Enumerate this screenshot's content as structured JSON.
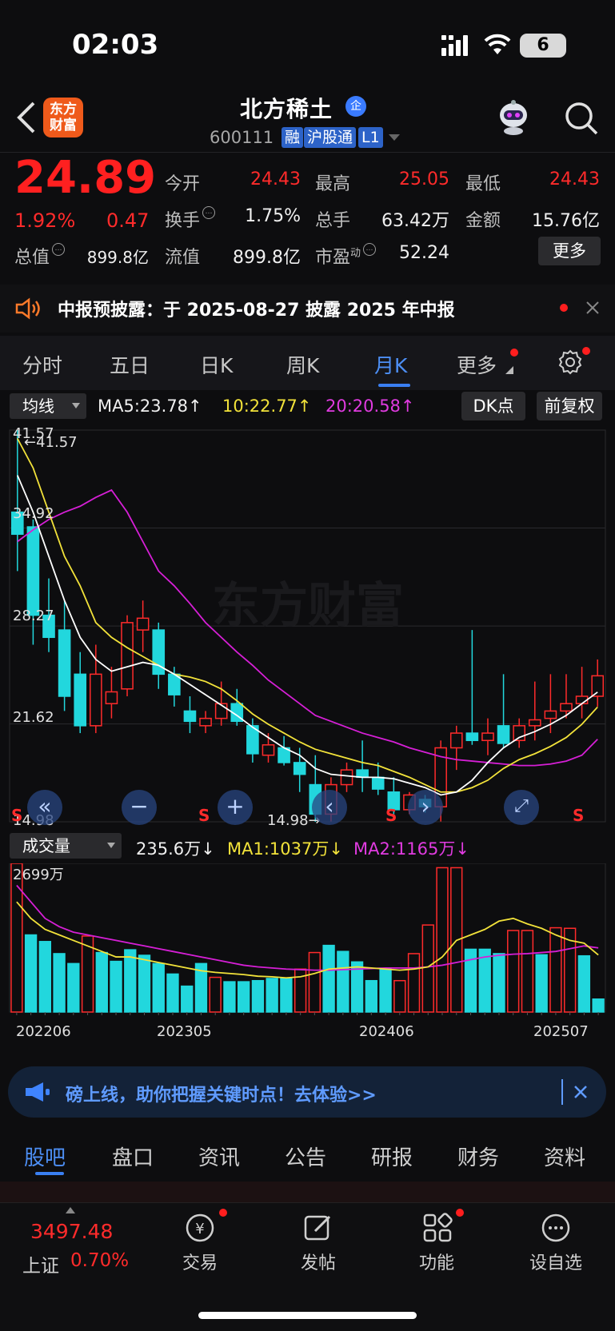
{
  "status": {
    "time": "02:03",
    "battery": "6"
  },
  "header": {
    "name": "北方稀土",
    "badge": "企",
    "code": "600111",
    "tags": [
      "融",
      "沪股通",
      "L1"
    ],
    "logo_lines": [
      "东方",
      "财富"
    ]
  },
  "quote": {
    "price": "24.89",
    "pct": "1.92%",
    "chg": "0.47",
    "open_label": "今开",
    "open": "24.43",
    "high_label": "最高",
    "high": "25.05",
    "low_label": "最低",
    "low": "24.43",
    "turnover_label": "换手",
    "turnover": "1.75%",
    "volume_label": "总手",
    "volume": "63.42万",
    "amount_label": "金额",
    "amount": "15.76亿",
    "mktcap_label": "总值",
    "mktcap": "899.8亿",
    "float_label": "流值",
    "float": "899.8亿",
    "pe_label": "市盈",
    "pe_sup": "动",
    "pe": "52.24",
    "more": "更多"
  },
  "notice": {
    "text": "中报预披露：于 2025-08-27 披露 2025 年中报"
  },
  "period_tabs": [
    "分时",
    "五日",
    "日K",
    "周K",
    "月K",
    "更多"
  ],
  "active_period": "月K",
  "kline": {
    "indicator": "均线",
    "ma5": "MA5:23.78↑",
    "ma10": "10:22.77↑",
    "ma20": "20:20.58↑",
    "dk": "DK点",
    "adjust": "前复权",
    "y_labels": [
      "41.57",
      "34.92",
      "28.27",
      "21.62",
      "14.98"
    ],
    "max_label": "←41.57",
    "min_label": "14.98→",
    "s_marks": [
      "S",
      "S",
      "S",
      "S"
    ]
  },
  "volume": {
    "indicator": "成交量",
    "vol": "235.6万↓",
    "ma1": "MA1:1037万↓",
    "ma2": "MA2:1165万↓",
    "y_label": "2699万",
    "x_labels": [
      "202206",
      "202305",
      "202406",
      "202507"
    ]
  },
  "colors": {
    "up": "#ff2b2b",
    "down": "#22d7dd",
    "ma5": "#ffffff",
    "ma10": "#f2e23a",
    "ma20": "#d61fd6",
    "accent": "#4d8ff5"
  },
  "chart_data": {
    "type": "candlestick",
    "period": "monthly",
    "x_labels": [
      "202206",
      "202305",
      "202406",
      "202507"
    ],
    "ylim": [
      14.98,
      41.57
    ],
    "candles": [
      [
        36.0,
        41.57,
        32.0,
        34.5
      ],
      [
        35.0,
        35.5,
        27.0,
        29.0
      ],
      [
        29.0,
        31.5,
        26.5,
        27.5
      ],
      [
        28.0,
        30.0,
        22.5,
        23.5
      ],
      [
        25.0,
        26.5,
        21.0,
        21.5
      ],
      [
        21.5,
        27.0,
        21.0,
        25.0
      ],
      [
        23.0,
        25.5,
        22.0,
        23.8
      ],
      [
        24.0,
        29.0,
        23.5,
        28.5
      ],
      [
        28.0,
        30.0,
        26.5,
        28.8
      ],
      [
        28.0,
        28.5,
        24.0,
        25.0
      ],
      [
        25.0,
        25.5,
        22.8,
        23.6
      ],
      [
        22.5,
        23.5,
        21.0,
        21.8
      ],
      [
        21.5,
        22.5,
        21.0,
        22.0
      ],
      [
        22.0,
        24.5,
        21.5,
        23.0
      ],
      [
        23.0,
        24.0,
        21.5,
        21.8
      ],
      [
        21.5,
        22.0,
        19.0,
        19.6
      ],
      [
        19.5,
        21.0,
        19.0,
        20.2
      ],
      [
        20.0,
        20.8,
        18.8,
        19.0
      ],
      [
        19.0,
        20.0,
        17.0,
        18.2
      ],
      [
        17.5,
        19.5,
        14.98,
        15.5
      ],
      [
        15.5,
        18.0,
        15.0,
        17.5
      ],
      [
        17.5,
        19.0,
        17.0,
        18.5
      ],
      [
        18.5,
        20.5,
        17.0,
        18.0
      ],
      [
        18.0,
        19.0,
        16.8,
        17.2
      ],
      [
        17.0,
        18.0,
        15.5,
        15.8
      ],
      [
        15.8,
        17.0,
        15.5,
        16.8
      ],
      [
        16.5,
        16.8,
        15.6,
        16.0
      ],
      [
        16.0,
        20.5,
        15.0,
        20.0
      ],
      [
        20.0,
        21.5,
        18.5,
        21.0
      ],
      [
        21.0,
        28.0,
        20.2,
        20.5
      ],
      [
        20.5,
        22.0,
        19.5,
        21.0
      ],
      [
        21.5,
        25.0,
        20.0,
        20.3
      ],
      [
        20.5,
        22.0,
        20.0,
        21.5
      ],
      [
        21.5,
        24.5,
        20.5,
        21.9
      ],
      [
        22.0,
        25.0,
        21.0,
        22.5
      ],
      [
        22.5,
        25.0,
        22.0,
        23.0
      ],
      [
        23.0,
        25.5,
        22.0,
        23.5
      ],
      [
        23.5,
        26.0,
        22.8,
        24.89
      ]
    ],
    "ma5": [
      38.5,
      36.0,
      33.0,
      30.0,
      27.5,
      26.0,
      25.2,
      25.5,
      25.8,
      25.6,
      25.0,
      24.3,
      23.6,
      22.9,
      22.2,
      21.4,
      20.7,
      20.0,
      19.5,
      18.6,
      18.2,
      18.1,
      18.0,
      18.0,
      17.9,
      17.6,
      17.3,
      16.8,
      17.0,
      17.8,
      19.0,
      20.0,
      20.7,
      21.1,
      21.6,
      22.2,
      23.0,
      23.78
    ],
    "ma10": [
      41.0,
      39.0,
      36.0,
      33.0,
      31.0,
      28.5,
      27.5,
      26.8,
      26.2,
      25.6,
      25.0,
      24.8,
      24.5,
      24.0,
      23.2,
      22.3,
      21.6,
      21.0,
      20.4,
      19.9,
      19.6,
      19.3,
      19.0,
      18.8,
      18.4,
      18.0,
      17.5,
      17.0,
      17.0,
      17.3,
      17.8,
      18.6,
      19.2,
      19.6,
      20.1,
      20.7,
      21.6,
      22.77
    ],
    "ma20": [
      34.0,
      34.8,
      35.5,
      36.0,
      36.4,
      37.0,
      37.5,
      36.0,
      34.0,
      32.0,
      31.0,
      29.8,
      28.5,
      27.5,
      26.5,
      25.6,
      24.6,
      23.8,
      23.0,
      22.2,
      21.8,
      21.4,
      21.0,
      20.7,
      20.4,
      20.0,
      19.7,
      19.4,
      19.2,
      19.1,
      19.0,
      18.9,
      18.8,
      18.8,
      18.9,
      19.1,
      19.5,
      20.58
    ],
    "volume_max": 2699,
    "volume": [
      2699,
      1400,
      1280,
      1060,
      880,
      1380,
      1080,
      920,
      1130,
      1030,
      880,
      690,
      470,
      880,
      630,
      550,
      550,
      570,
      610,
      610,
      780,
      1080,
      1210,
      1100,
      910,
      570,
      790,
      570,
      1060,
      1580,
      2620,
      2620,
      1140,
      1140,
      1060,
      1480,
      1480,
      1040,
      1530,
      1520,
      1020,
      235.6
    ],
    "vol_ma1": [
      2000,
      1700,
      1500,
      1400,
      1300,
      1200,
      1100,
      1000,
      1000,
      950,
      900,
      850,
      800,
      750,
      720,
      700,
      680,
      650,
      640,
      620,
      640,
      700,
      780,
      800,
      820,
      800,
      780,
      760,
      780,
      820,
      1000,
      1300,
      1400,
      1500,
      1650,
      1700,
      1600,
      1520,
      1400,
      1300,
      1250,
      1037
    ],
    "vol_ma2": [
      2300,
      2000,
      1700,
      1550,
      1450,
      1400,
      1350,
      1300,
      1250,
      1200,
      1150,
      1100,
      1050,
      1000,
      950,
      900,
      850,
      820,
      800,
      780,
      770,
      760,
      760,
      770,
      780,
      790,
      800,
      800,
      800,
      820,
      850,
      900,
      950,
      1000,
      1030,
      1050,
      1060,
      1080,
      1100,
      1150,
      1200,
      1165
    ]
  },
  "promo": {
    "text": "磅上线，助你把握关键时点！去体验>>"
  },
  "content_tabs": [
    "股吧",
    "盘口",
    "资讯",
    "公告",
    "研报",
    "财务",
    "资料"
  ],
  "bottom": {
    "index_value": "3497.48",
    "index_name": "上证",
    "index_pct": "0.70%",
    "items": [
      "交易",
      "发帖",
      "功能",
      "设自选"
    ]
  }
}
